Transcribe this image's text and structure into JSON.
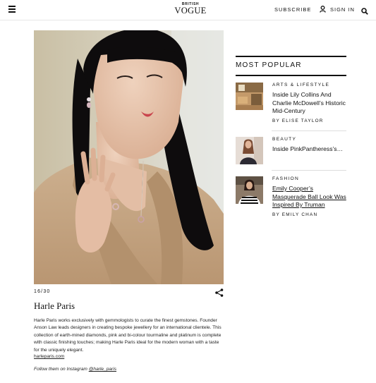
{
  "header": {
    "brand_top": "BRITISH",
    "brand": "VOGUE",
    "subscribe": "SUBSCRIBE",
    "sign_in": "SIGN IN"
  },
  "slide": {
    "counter": "16/30",
    "title": "Harle Paris",
    "description": "Harle Paris works exclusively with gemmologists to curate the finest gemstones. Founder Anson Law leads designers in creating bespoke jewellery for an international clientele. This collection of earth-mined diamonds, pink and bi-colour tourmaline and platinum is complete with classic finishing touches; making Harle Paris ideal for the modern woman with a taste for the uniquely elegant.",
    "link": "harleparis.com",
    "follow_prefix": "Follow them on Instagram ",
    "follow_handle": "@harle_paris"
  },
  "most_popular": {
    "heading": "MOST POPULAR",
    "items": [
      {
        "category": "ARTS & LIFESTYLE",
        "title": "Inside Lily Collins And Charlie McDowell’s Historic Mid-Century",
        "byline": "BY ELISE TAYLOR"
      },
      {
        "category": "BEAUTY",
        "title": "Inside PinkPantheress’s…",
        "byline": ""
      },
      {
        "category": "FASHION",
        "title": "Emily Cooper’s Masquerade Ball Look Was Inspired By Truman",
        "byline": "BY EMILY CHAN"
      }
    ]
  },
  "colors": {
    "text": "#111111",
    "rule": "#111111",
    "divider": "#dddddd"
  },
  "icons": [
    "hamburger-icon",
    "user-icon",
    "search-icon",
    "share-icon"
  ]
}
